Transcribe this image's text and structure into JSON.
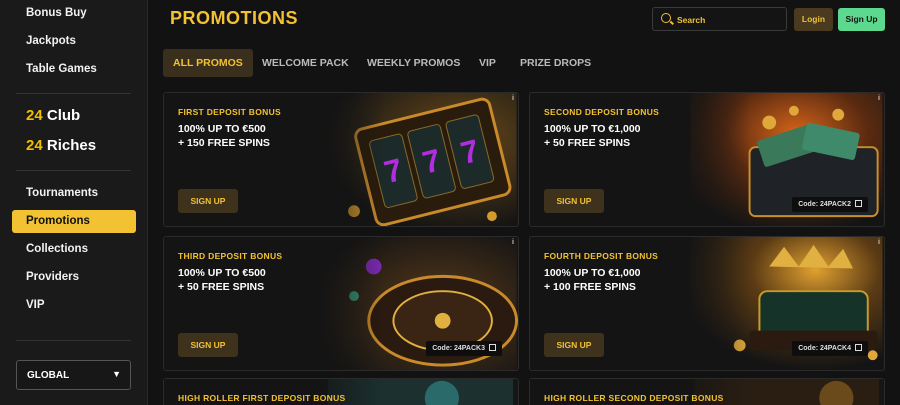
{
  "sidebar": {
    "items_top": [
      "Bonus Buy",
      "Jackpots",
      "Table Games"
    ],
    "club": {
      "num": "24",
      "word": "Club"
    },
    "riches": {
      "num": "24",
      "word": "Riches"
    },
    "items_bottom": [
      "Tournaments",
      "Promotions",
      "Collections",
      "Providers",
      "VIP"
    ],
    "active": "Promotions",
    "region": "GLOBAL"
  },
  "header": {
    "title": "PROMOTIONS",
    "search_placeholder": "Search",
    "login_label": "Login",
    "signup_label": "Sign Up"
  },
  "tabs": [
    "ALL PROMOS",
    "WELCOME PACK",
    "WEEKLY PROMOS",
    "VIP",
    "PRIZE DROPS"
  ],
  "cards": [
    {
      "title": "FIRST DEPOSIT BONUS",
      "line1": "100% UP TO €500",
      "line2": "+ 150 FREE SPINS",
      "button": "SIGN UP",
      "code": ""
    },
    {
      "title": "SECOND DEPOSIT BONUS",
      "line1": "100% UP TO €1,000",
      "line2": "+ 50 FREE SPINS",
      "button": "SIGN UP",
      "code": "Code: 24PACK2"
    },
    {
      "title": "THIRD DEPOSIT BONUS",
      "line1": "100% UP TO €500",
      "line2": "+ 50 FREE SPINS",
      "button": "SIGN UP",
      "code": "Code: 24PACK3"
    },
    {
      "title": "FOURTH DEPOSIT BONUS",
      "line1": "100% UP TO €1,000",
      "line2": "+ 100 FREE SPINS",
      "button": "SIGN UP",
      "code": "Code: 24PACK4"
    },
    {
      "title": "HIGH ROLLER FIRST DEPOSIT BONUS"
    },
    {
      "title": "HIGH ROLLER SECOND DEPOSIT BONUS"
    }
  ],
  "info_mark": "i",
  "colors": {
    "accent": "#f2c233",
    "signup": "#5dd98f",
    "bg": "#121212",
    "sidebar": "#1a1a1a"
  }
}
